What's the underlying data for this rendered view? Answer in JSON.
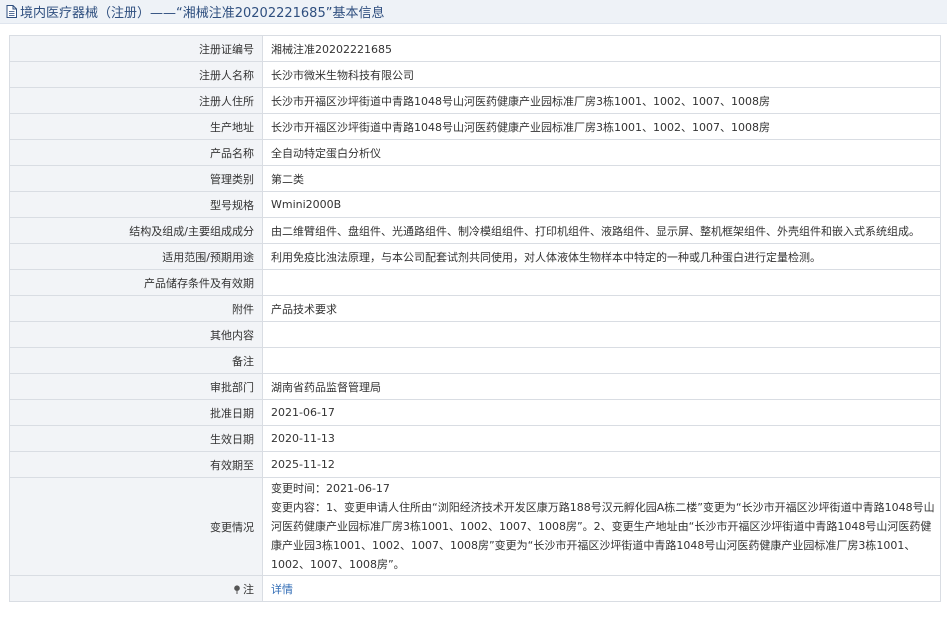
{
  "header": {
    "title": "境内医疗器械（注册）——“湘械注准20202221685”基本信息"
  },
  "rows": [
    {
      "label": "注册证编号",
      "value": "湘械注准20202221685"
    },
    {
      "label": "注册人名称",
      "value": "长沙市微米生物科技有限公司"
    },
    {
      "label": "注册人住所",
      "value": "长沙市开福区沙坪街道中青路1048号山河医药健康产业园标准厂房3栋1001、1002、1007、1008房"
    },
    {
      "label": "生产地址",
      "value": "长沙市开福区沙坪街道中青路1048号山河医药健康产业园标准厂房3栋1001、1002、1007、1008房"
    },
    {
      "label": "产品名称",
      "value": "全自动特定蛋白分析仪"
    },
    {
      "label": "管理类别",
      "value": "第二类"
    },
    {
      "label": "型号规格",
      "value": "Wmini2000B"
    },
    {
      "label": "结构及组成/主要组成成分",
      "value": "由二维臂组件、盘组件、光通路组件、制冷模组组件、打印机组件、液路组件、显示屏、整机框架组件、外壳组件和嵌入式系统组成。"
    },
    {
      "label": "适用范围/预期用途",
      "value": "利用免疫比浊法原理，与本公司配套试剂共同使用，对人体液体生物样本中特定的一种或几种蛋白进行定量检测。"
    },
    {
      "label": "产品储存条件及有效期",
      "value": ""
    },
    {
      "label": "附件",
      "value": "产品技术要求"
    },
    {
      "label": "其他内容",
      "value": ""
    },
    {
      "label": "备注",
      "value": ""
    },
    {
      "label": "审批部门",
      "value": "湖南省药品监督管理局"
    },
    {
      "label": "批准日期",
      "value": "2021-06-17"
    },
    {
      "label": "生效日期",
      "value": "2020-11-13"
    },
    {
      "label": "有效期至",
      "value": "2025-11-12"
    }
  ],
  "change": {
    "label": "变更情况",
    "time": "变更时间：2021-06-17",
    "content": "变更内容：1、变更申请人住所由“浏阳经济技术开发区康万路188号汉元孵化园A栋二楼”变更为“长沙市开福区沙坪街道中青路1048号山河医药健康产业园标准厂房3栋1001、1002、1007、1008房”。2、变更生产地址由“长沙市开福区沙坪街道中青路1048号山河医药健康产业园3栋1001、1002、1007、1008房”变更为“长沙市开福区沙坪街道中青路1048号山河医药健康产业园标准厂房3栋1001、1002、1007、1008房”。"
  },
  "note": {
    "label": "注",
    "link": "详情"
  },
  "icons": {
    "title_icon": "document-icon",
    "note_icon": "pin-icon"
  },
  "colors": {
    "title_text": "#2f4f7f",
    "label_bg": "#f2f4f7",
    "border": "#d9dde3",
    "link": "#2f6bb5"
  }
}
